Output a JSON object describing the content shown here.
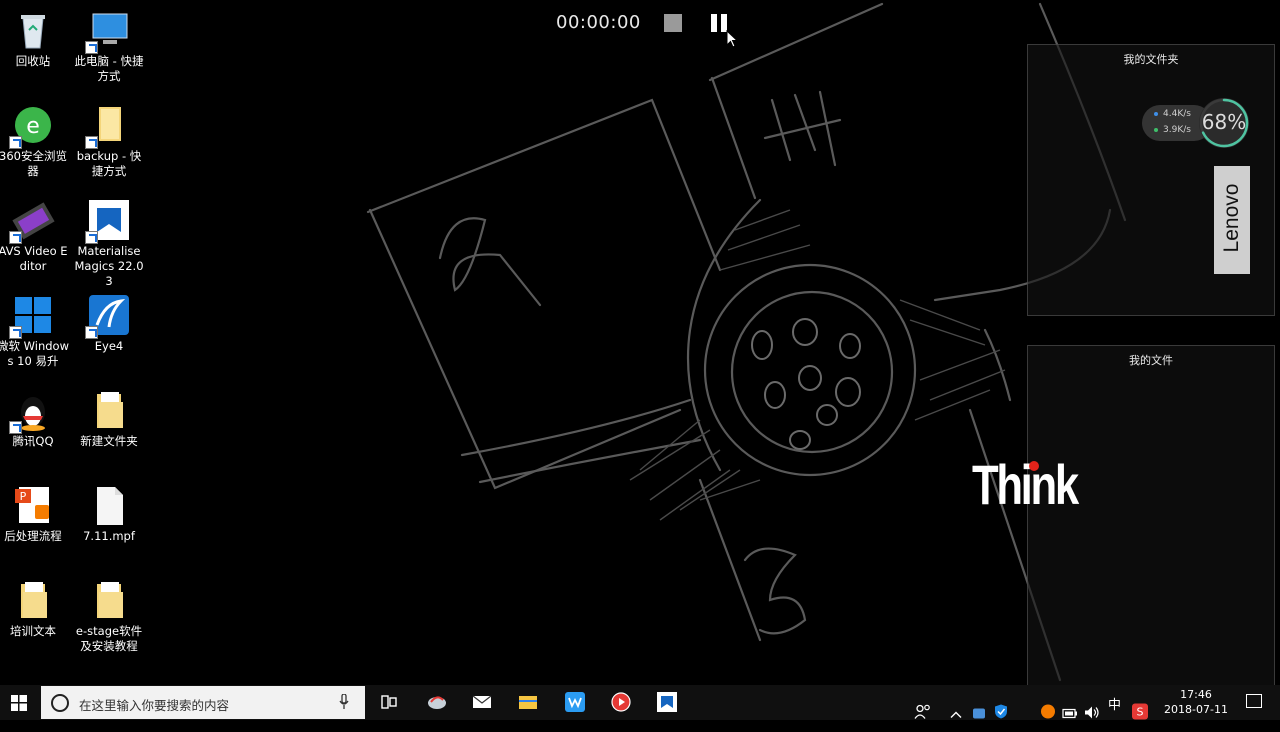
{
  "desktop_icons": [
    {
      "label": "回收站",
      "icon": "recycle-bin-icon"
    },
    {
      "label": "此电脑 - 快捷方式",
      "icon": "this-pc-icon"
    },
    {
      "label": "360安全浏览器",
      "icon": "360-browser-icon"
    },
    {
      "label": "backup - 快捷方式",
      "icon": "folder-icon"
    },
    {
      "label": "AVS Video Editor",
      "icon": "avs-video-editor-icon"
    },
    {
      "label": "Materialise Magics 22.03",
      "icon": "materialise-magics-icon"
    },
    {
      "label": "微软 Windows 10 易升",
      "icon": "windows-logo-icon"
    },
    {
      "label": "Eye4",
      "icon": "eye4-icon"
    },
    {
      "label": "腾讯QQ",
      "icon": "qq-penguin-icon"
    },
    {
      "label": "新建文件夹",
      "icon": "folder-icon"
    },
    {
      "label": "后处理流程",
      "icon": "powerpoint-file-icon"
    },
    {
      "label": "7.11.mpf",
      "icon": "blank-file-icon"
    },
    {
      "label": "培训文本",
      "icon": "folder-icon"
    },
    {
      "label": "e-stage软件及安装教程",
      "icon": "folder-icon"
    }
  ],
  "recording": {
    "time": "00:00:00"
  },
  "fences": {
    "top_title": "我的文件夹",
    "bottom_title": "我的文件"
  },
  "net_monitor": {
    "up": "4.4K/s",
    "down": "3.9K/s",
    "gauge_text": "68%",
    "gauge_value": 68
  },
  "branding": {
    "lenovo": "Lenovo",
    "think": "Think"
  },
  "taskbar": {
    "search_placeholder": "在这里输入你要搜索的内容",
    "ime": "中",
    "time": "17:46",
    "date": "2018-07-11"
  },
  "colors": {
    "accent": "#1a6dd6",
    "think_dot": "#e2231a",
    "gauge_ring": "#4fc3a1"
  }
}
